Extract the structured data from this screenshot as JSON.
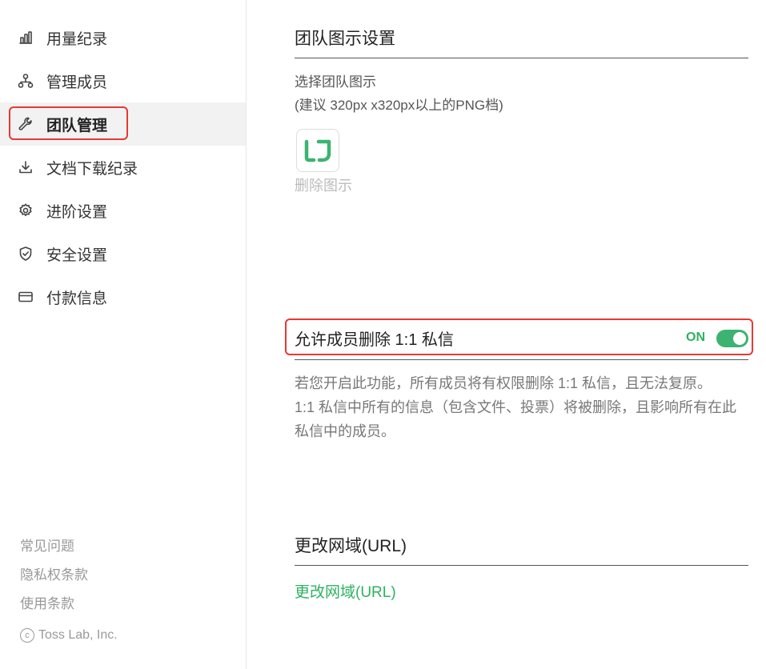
{
  "sidebar": {
    "items": [
      {
        "label": "用量纪录",
        "icon": "bar-chart-icon"
      },
      {
        "label": "管理成员",
        "icon": "org-chart-icon"
      },
      {
        "label": "团队管理",
        "icon": "wrench-icon"
      },
      {
        "label": "文档下载纪录",
        "icon": "download-icon"
      },
      {
        "label": "进阶设置",
        "icon": "gear-icon"
      },
      {
        "label": "安全设置",
        "icon": "shield-check-icon"
      },
      {
        "label": "付款信息",
        "icon": "credit-card-icon"
      }
    ],
    "active_index": 2,
    "footer": {
      "faq": "常见问题",
      "privacy": "隐私权条款",
      "terms": "使用条款",
      "copyright": "Toss Lab, Inc."
    }
  },
  "team_logo": {
    "title": "团队图示设置",
    "select_label": "选择团队图示",
    "hint": "(建议 320px x320px以上的PNG档)",
    "delete_label": "删除图示",
    "logo_color": "#3cb371"
  },
  "dm_delete": {
    "label": "允许成员删除 1:1 私信",
    "state": "ON",
    "enabled": true,
    "desc_line1": "若您开启此功能，所有成员将有权限删除 1:1 私信，且无法复原。",
    "desc_line2": "1:1 私信中所有的信息（包含文件、投票）将被删除，且影响所有在此私信中的成员。"
  },
  "domain": {
    "title": "更改网域(URL)",
    "link": "更改网域(URL)"
  },
  "colors": {
    "accent": "#2db260",
    "highlight": "#e53935"
  }
}
